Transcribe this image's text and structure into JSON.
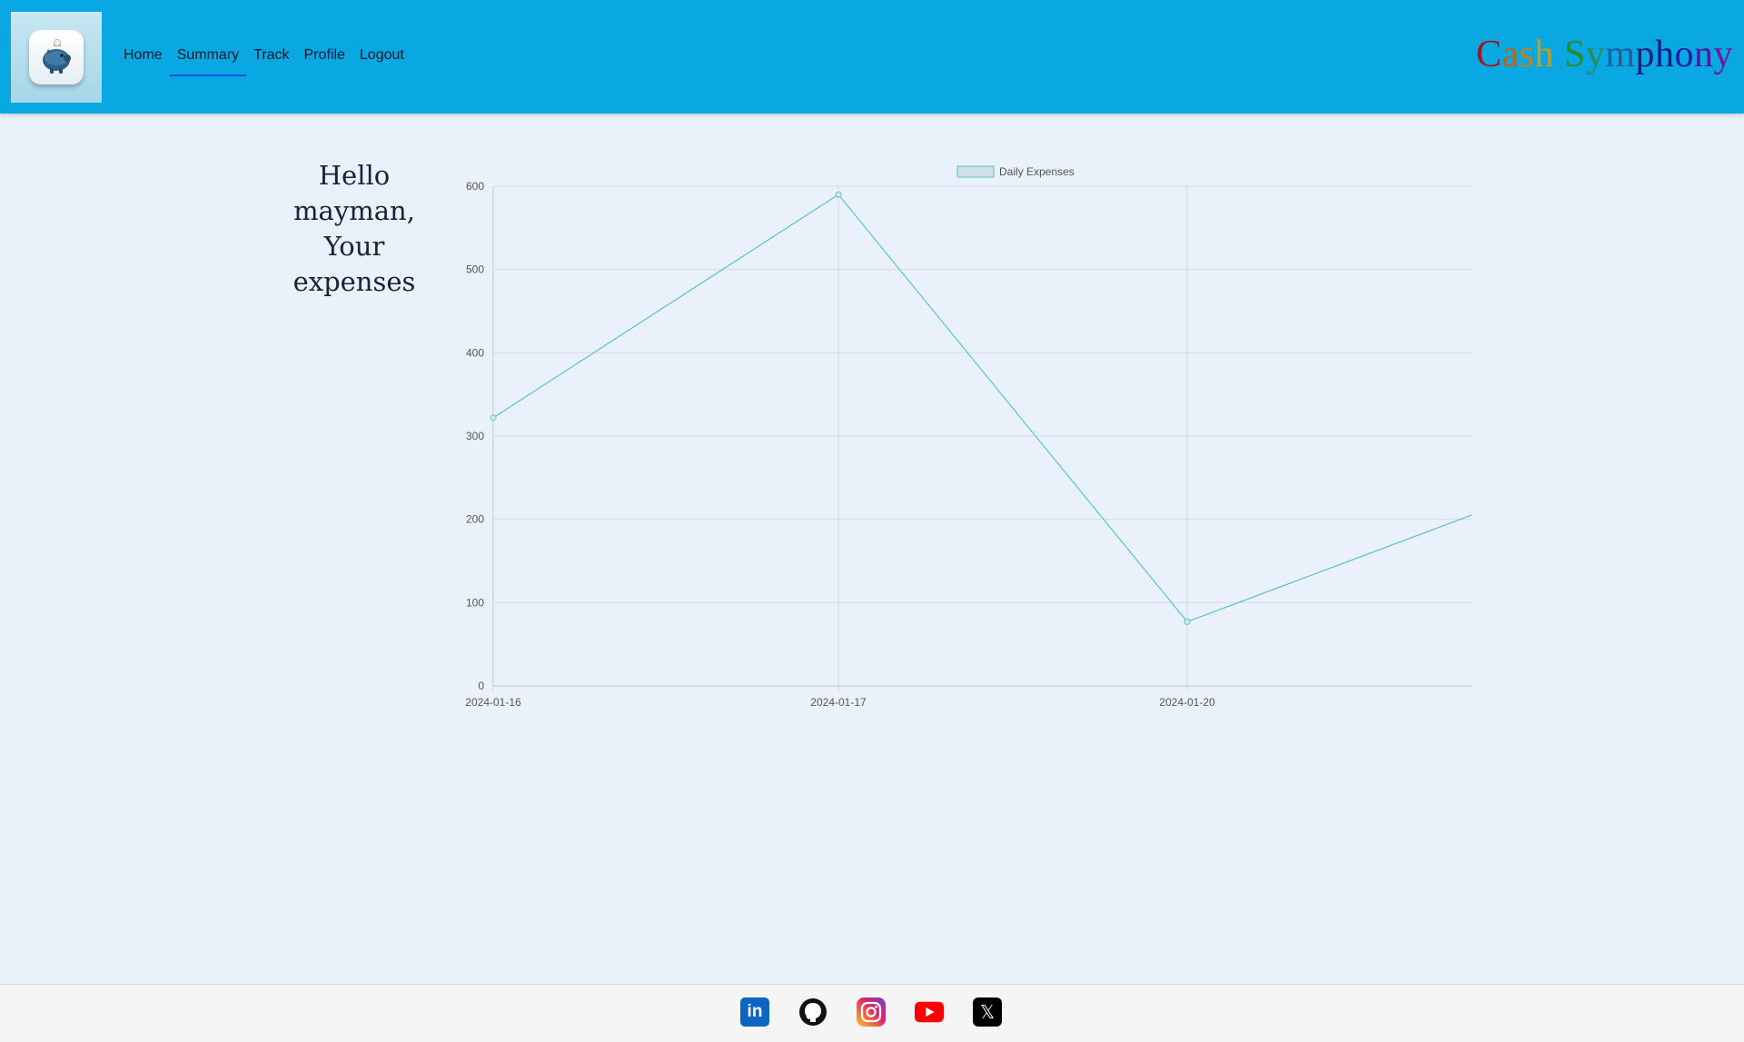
{
  "header": {
    "logo": "piggy-bank-logo",
    "nav": [
      {
        "label": "Home",
        "active": false
      },
      {
        "label": "Summary",
        "active": true
      },
      {
        "label": "Track",
        "active": false
      },
      {
        "label": "Profile",
        "active": false
      },
      {
        "label": "Logout",
        "active": false
      }
    ],
    "brand": {
      "text": "Cash Symphony",
      "letter_colors": [
        "#a4161a",
        "#b5651d",
        "#c7801b",
        "#c79a1a",
        "#ffffff",
        "#2d8a2d",
        "#2e8b57",
        "#1f5f9e",
        "#1a237e",
        "#0d1a8c",
        "#1a1aa6",
        "#4a1aa6",
        "#6a1b9a"
      ]
    }
  },
  "greeting": {
    "text": "Hello mayman, Your expenses"
  },
  "chart_data": {
    "type": "line",
    "legend": "Daily Expenses",
    "legend_position": "top-center",
    "x": [
      "2024-01-16",
      "2024-01-17",
      "2024-01-20",
      ""
    ],
    "series": [
      {
        "name": "Daily Expenses",
        "values": [
          322,
          590,
          77,
          205
        ]
      }
    ],
    "ylim": [
      0,
      600
    ],
    "yticks": [
      0,
      100,
      200,
      300,
      400,
      500,
      600
    ],
    "xticks": [
      "2024-01-16",
      "2024-01-17",
      "2024-01-20"
    ],
    "grid": true,
    "line_color": "#5cc5c0",
    "legend_fill": "#cfe0e6"
  },
  "footer": {
    "socials": [
      {
        "name": "linkedin",
        "label": "in"
      },
      {
        "name": "github",
        "label": ""
      },
      {
        "name": "instagram",
        "label": ""
      },
      {
        "name": "youtube",
        "label": ""
      },
      {
        "name": "x",
        "label": "𝕏"
      }
    ]
  }
}
